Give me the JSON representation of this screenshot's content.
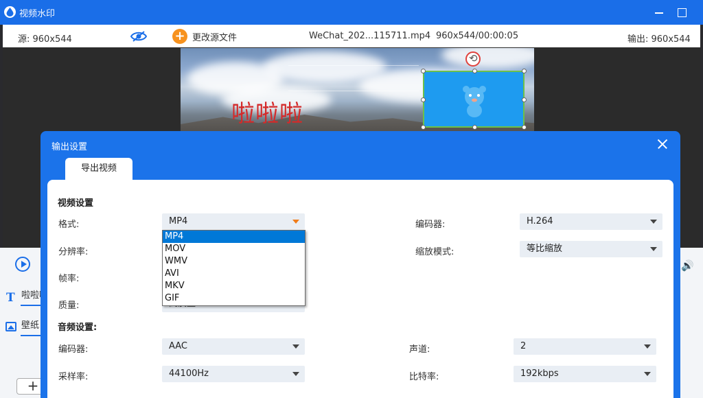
{
  "window": {
    "title": "视频水印"
  },
  "infobar": {
    "source": "源:  960x544",
    "change_source": "更改源文件",
    "file_name": "WeChat_202...115711.mp4",
    "file_info": "960x544/00:00:05",
    "output": "输出:  960x544"
  },
  "preview": {
    "watermark_text": "啦啦啦"
  },
  "sidebar": {
    "text_item": "啦啦啦",
    "image_item": "壁纸"
  },
  "dialog": {
    "title": "输出设置",
    "tab": "导出视频",
    "video_section": "视频设置",
    "audio_section": "音频设置:",
    "format_label": "格式:",
    "format_value": "MP4",
    "format_options": [
      "MP4",
      "MOV",
      "WMV",
      "AVI",
      "MKV",
      "GIF"
    ],
    "resolution_label": "分辨率:",
    "framerate_label": "帧率:",
    "quality_label": "质量:",
    "quality_value": "高质量",
    "video_encoder_label": "编码器:",
    "video_encoder_value": "H.264",
    "scale_label": "缩放模式:",
    "scale_value": "等比缩放",
    "audio_encoder_label": "编码器:",
    "audio_encoder_value": "AAC",
    "channel_label": "声道:",
    "channel_value": "2",
    "samplerate_label": "采样率:",
    "samplerate_value": "44100Hz",
    "bitrate_label": "比特率:",
    "bitrate_value": "192kbps"
  },
  "colors": {
    "accent": "#1a6ee8",
    "dropdown_selected": "#0078d7",
    "watermark_text": "#d42a2a",
    "orange": "#f7921e"
  }
}
